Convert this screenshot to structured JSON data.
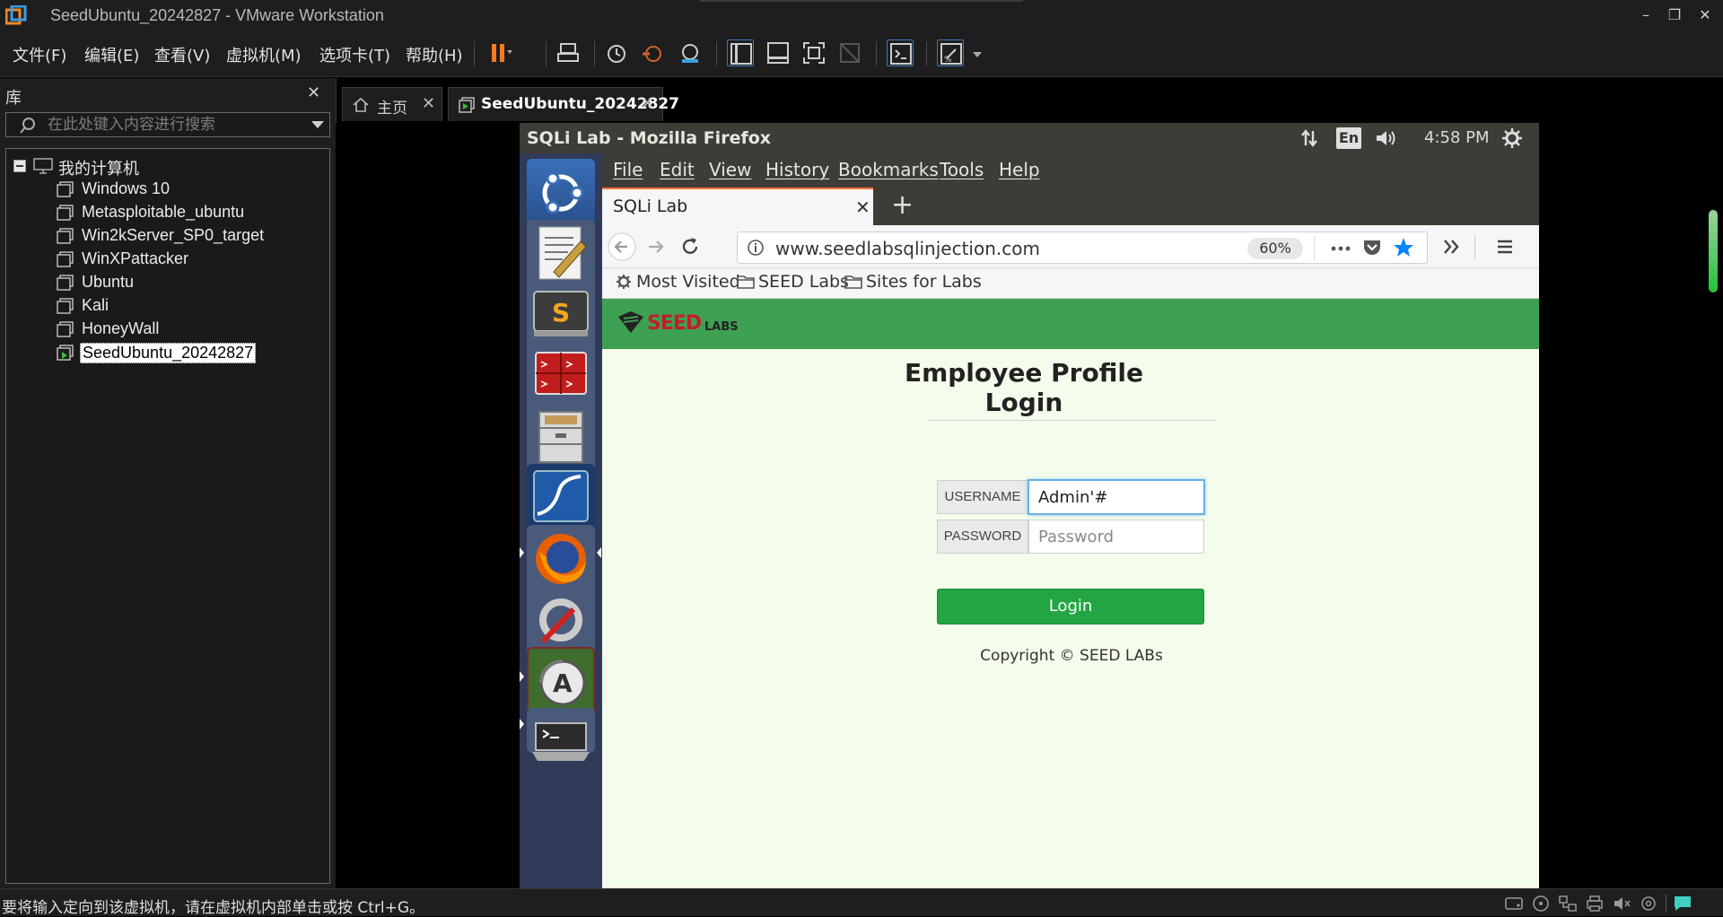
{
  "window": {
    "title": "SeedUbuntu_20242827 - VMware Workstation",
    "controls": {
      "minimize": "–",
      "restore": "❐",
      "close": "✕"
    }
  },
  "menubar": {
    "items": [
      "文件(F)",
      "编辑(E)",
      "查看(V)",
      "虚拟机(M)",
      "选项卡(T)",
      "帮助(H)"
    ]
  },
  "library": {
    "title": "库",
    "close": "✕",
    "search_placeholder": "在此处键入内容进行搜索",
    "root": "我的计算机",
    "vms": [
      {
        "name": "Windows 10",
        "running": false,
        "selected": false
      },
      {
        "name": "Metasploitable_ubuntu",
        "running": false,
        "selected": false
      },
      {
        "name": "Win2kServer_SP0_target",
        "running": false,
        "selected": false
      },
      {
        "name": "WinXPattacker",
        "running": false,
        "selected": false
      },
      {
        "name": "Ubuntu",
        "running": false,
        "selected": false
      },
      {
        "name": "Kali",
        "running": false,
        "selected": false
      },
      {
        "name": "HoneyWall",
        "running": false,
        "selected": false
      },
      {
        "name": "SeedUbuntu_20242827",
        "running": true,
        "selected": true
      }
    ]
  },
  "tabs": [
    {
      "label": "主页",
      "icon": "home-icon",
      "close": "✕",
      "active": false
    },
    {
      "label": "SeedUbuntu_20242827",
      "icon": "vm-running-icon",
      "close": "✕",
      "active": true
    }
  ],
  "statusbar": {
    "text": "要将输入定向到该虚拟机，请在虚拟机内部单击或按 Ctrl+G。"
  },
  "guest": {
    "topbar": {
      "title": "SQLi Lab - Mozilla Firefox",
      "lang": "En",
      "time": "4:58 PM"
    },
    "firefox": {
      "menu": [
        "File",
        "Edit",
        "View",
        "History",
        "Bookmarks",
        "Tools",
        "Help"
      ],
      "tab_title": "SQLi Lab",
      "tab_close": "✕",
      "new_tab": "+",
      "url": "www.seedlabsqlinjection.com",
      "zoom": "60%",
      "bookmarks": [
        "Most Visited",
        "SEED Labs",
        "Sites for Labs"
      ]
    },
    "page": {
      "logo_text": "SEEDLABS",
      "title": "Employee Profile Login",
      "username_label": "USERNAME",
      "username_value": "Admin'#",
      "password_label": "PASSWORD",
      "password_placeholder": "Password",
      "login_button": "Login",
      "copyright": "Copyright © SEED LABs"
    }
  },
  "colors": {
    "accent_orange": "#f57c20",
    "seed_green": "#3ea052",
    "login_green": "#22a542",
    "page_bg": "#f4fdeb",
    "launcher_bg": "#303b5a"
  }
}
